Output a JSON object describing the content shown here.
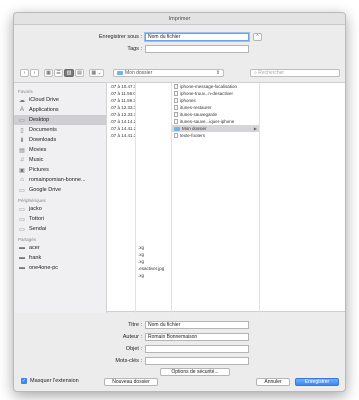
{
  "window": {
    "title": "Imprimer"
  },
  "save": {
    "save_as_label": "Enregistrer sous :",
    "save_as_value": "Nom du fichier",
    "tags_label": "Tags :",
    "tags_value": ""
  },
  "toolbar": {
    "back": "‹",
    "forward": "›",
    "view_icons": "▦",
    "view_list": "☰",
    "view_columns": "▥",
    "view_coverflow": "▤",
    "arrange": "▦",
    "location": "Mon dossier",
    "search_placeholder": "Rechercher"
  },
  "sidebar": {
    "sections": [
      {
        "title": "Favoris",
        "items": [
          {
            "label": "iCloud Drive",
            "icon": "cloud-icon",
            "glyph": "☁"
          },
          {
            "label": "Applications",
            "icon": "applications-icon",
            "glyph": "A"
          },
          {
            "label": "Desktop",
            "icon": "desktop-icon",
            "glyph": "▭",
            "selected": true
          },
          {
            "label": "Documents",
            "icon": "documents-icon",
            "glyph": "▯"
          },
          {
            "label": "Downloads",
            "icon": "downloads-icon",
            "glyph": "⬇"
          },
          {
            "label": "Movies",
            "icon": "movies-icon",
            "glyph": "▤"
          },
          {
            "label": "Music",
            "icon": "music-icon",
            "glyph": "♫"
          },
          {
            "label": "Pictures",
            "icon": "pictures-icon",
            "glyph": "▣"
          },
          {
            "label": "romainpomian-bonne...",
            "icon": "home-icon",
            "glyph": "⌂"
          },
          {
            "label": "Google Drive",
            "icon": "folder-icon",
            "glyph": "▭"
          }
        ]
      },
      {
        "title": "Périphériques",
        "items": [
          {
            "label": "jacko",
            "icon": "drive-icon",
            "glyph": "▭"
          },
          {
            "label": "Tottori",
            "icon": "drive-icon",
            "glyph": "▭"
          },
          {
            "label": "Sendai",
            "icon": "drive-icon",
            "glyph": "▭"
          }
        ]
      },
      {
        "title": "Partagés",
        "items": [
          {
            "label": "acer",
            "icon": "computer-icon",
            "glyph": "▬"
          },
          {
            "label": "frank",
            "icon": "computer-icon",
            "glyph": "▬"
          },
          {
            "label": "one4one-pc",
            "icon": "computer-icon",
            "glyph": "▬"
          }
        ]
      }
    ]
  },
  "columns": {
    "col1": [
      ".07 à 10.47.18",
      ".07 à 11.59.05",
      ".07 à 11.59.31",
      ".07 à 12.33.10",
      ".07 à 12.33.12",
      ".07 à 14.14.28",
      ".07 à 14.41.27",
      ".07 à 14.41.38"
    ],
    "col2": [
      "",
      "",
      "",
      "",
      "",
      "",
      "",
      "",
      "",
      "",
      "",
      "",
      "",
      "",
      "",
      "",
      "",
      "",
      "",
      "",
      "",
      "",
      "",
      ".xg",
      ".xg",
      ".xg",
      ".esactiver.jpg",
      ".xg"
    ],
    "col3": [
      {
        "label": "iphone-message-localisation",
        "type": "doc"
      },
      {
        "label": "iphone-trouv...n-desactiver",
        "type": "doc"
      },
      {
        "label": "iphones",
        "type": "doc"
      },
      {
        "label": "itunes-restaurer",
        "type": "doc"
      },
      {
        "label": "itunes-sauvegarde",
        "type": "doc"
      },
      {
        "label": "itunes-sauve...iquer-iphone",
        "type": "doc"
      },
      {
        "label": "Mon dossier",
        "type": "folder",
        "selected": true
      },
      {
        "label": "texte-footers",
        "type": "doc"
      }
    ]
  },
  "meta": {
    "title_label": "Titre :",
    "title_value": "Nom du fichier",
    "author_label": "Auteur :",
    "author_value": "Romain Bonnemaison",
    "subject_label": "Objet :",
    "subject_value": "",
    "keywords_label": "Mots-clés :",
    "keywords_value": "",
    "security_button": "Options de sécurité..."
  },
  "bottom": {
    "hide_extension": "Masquer l'extension",
    "new_folder": "Nouveau dossier",
    "cancel": "Annuler",
    "save": "Enregistrer"
  }
}
